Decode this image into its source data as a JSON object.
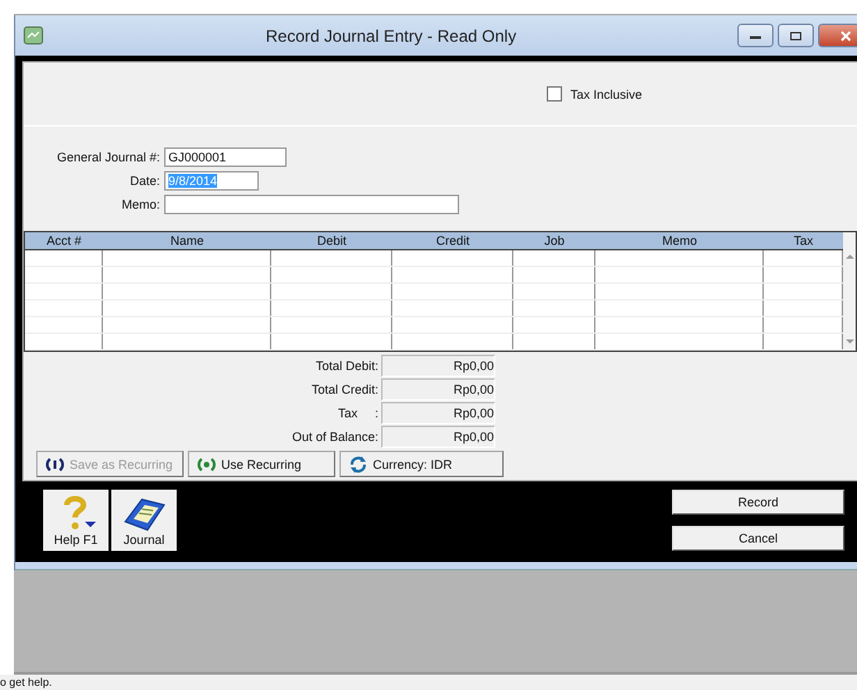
{
  "window": {
    "title": "Record Journal Entry - Read Only"
  },
  "tax_inclusive": {
    "label": "Tax Inclusive",
    "checked": false
  },
  "form": {
    "journal_label": "General Journal #:",
    "journal_value": "GJ000001",
    "date_label": "Date:",
    "date_value": "9/8/2014",
    "date_text_selected": true,
    "memo_label": "Memo:"
  },
  "table": {
    "columns": [
      "Acct #",
      "Name",
      "Debit",
      "Credit",
      "Job",
      "Memo",
      "Tax"
    ]
  },
  "totals": [
    {
      "label": "Total Debit:",
      "value": "Rp0,00"
    },
    {
      "label": "Total Credit:",
      "value": "Rp0,00"
    },
    {
      "label": "Tax     :",
      "value": "Rp0,00"
    },
    {
      "label": "Out of Balance:",
      "value": "Rp0,00"
    }
  ],
  "action_buttons": [
    {
      "kind": "save",
      "label": "Save as Recurring",
      "disabled": true
    },
    {
      "kind": "use",
      "label": "Use Recurring",
      "disabled": false
    },
    {
      "kind": "currency",
      "label": "Currency:  IDR",
      "disabled": false
    }
  ],
  "toolbar": [
    {
      "kind": "help",
      "label": "Help F1"
    },
    {
      "kind": "journal",
      "label": "Journal"
    }
  ],
  "dialog_buttons": [
    "Record",
    "Cancel"
  ],
  "status_bar": "o get help."
}
